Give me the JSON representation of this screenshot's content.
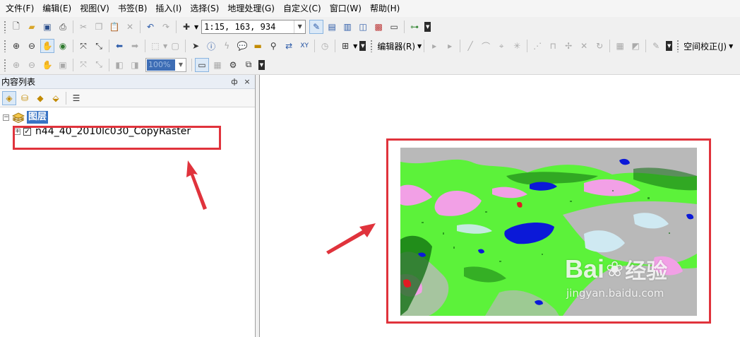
{
  "menu": [
    "文件(F)",
    "编辑(E)",
    "视图(V)",
    "书签(B)",
    "插入(I)",
    "选择(S)",
    "地理处理(G)",
    "自定义(C)",
    "窗口(W)",
    "帮助(H)"
  ],
  "toolbar": {
    "scale": "1:15, 163, 934",
    "editor_label": "编辑器(R)",
    "spatial_adjust_label": "空间校正(J)",
    "zoom_percent": "100%"
  },
  "toc": {
    "title": "内容列表",
    "pin_glyph": "ф",
    "close_glyph": "×",
    "group_name": "图层",
    "layer_name": "n44_40_2010lc030_CopyRaster",
    "layer_checked": true
  },
  "watermark": {
    "brand": "Bai",
    "brand_tail": "经验",
    "url": "jingyan.baidu.com"
  },
  "colors": {
    "highlight": "#e0333c",
    "land_green": "#5cf23a",
    "grass_gray": "#b9b9b9",
    "pink": "#f2a0e6",
    "water": "#0b19d8",
    "snow": "#cfe9f2",
    "forest": "#0e6b10",
    "red": "#e01b23"
  },
  "icons": {
    "tb1": [
      "new-document-icon",
      "open-folder-icon",
      "save-icon",
      "print-icon",
      "cut-icon",
      "copy-icon",
      "paste-icon",
      "delete-icon",
      "undo-icon",
      "redo-icon",
      "add-data-icon"
    ],
    "tb2": [
      "zoom-in-icon",
      "zoom-out-icon",
      "pan-icon",
      "full-extent-icon",
      "fixed-zoom-in-icon",
      "fixed-zoom-out-icon",
      "back-icon",
      "forward-icon",
      "select-features-icon",
      "clear-selection-icon",
      "select-elements-icon",
      "identify-icon",
      "hyperlink-icon",
      "html-popup-icon",
      "measure-icon",
      "find-icon",
      "find-route-icon",
      "goto-xy-icon"
    ]
  }
}
